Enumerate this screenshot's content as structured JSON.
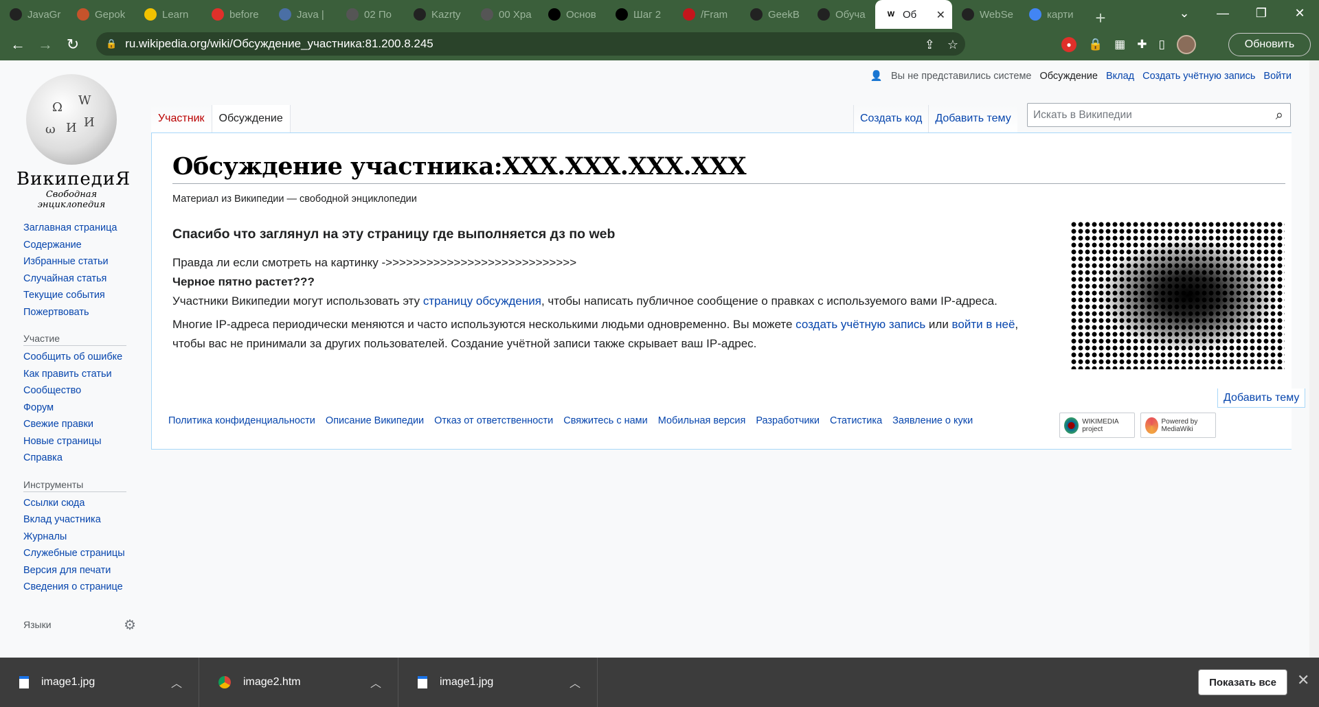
{
  "browser": {
    "tabs": [
      {
        "label": "JavaGr",
        "icon": "github-icon",
        "color": "#222"
      },
      {
        "label": "Gepok",
        "icon": "site-icon",
        "color": "#c5532b"
      },
      {
        "label": "Learn",
        "icon": "key-icon",
        "color": "#f2c200"
      },
      {
        "label": "before",
        "icon": "site-icon",
        "color": "#e0302a"
      },
      {
        "label": "Java |",
        "icon": "site-icon",
        "color": "#4a6fa5"
      },
      {
        "label": "02 По",
        "icon": "globe-icon",
        "color": "#555"
      },
      {
        "label": "Kazrty",
        "icon": "github-icon",
        "color": "#222"
      },
      {
        "label": "00 Хра",
        "icon": "globe-icon",
        "color": "#555"
      },
      {
        "label": "Основ",
        "icon": "site-icon",
        "color": "#000"
      },
      {
        "label": "Шаг 2",
        "icon": "site-icon",
        "color": "#000"
      },
      {
        "label": "/Fram",
        "icon": "site-icon",
        "color": "#c4161c"
      },
      {
        "label": "GeekB",
        "icon": "site-icon",
        "color": "#222"
      },
      {
        "label": "Обуча",
        "icon": "site-icon",
        "color": "#222"
      },
      {
        "label": "Об",
        "icon": "wikipedia-icon",
        "color": "#fff",
        "active": true
      },
      {
        "label": "WebSe",
        "icon": "github-icon",
        "color": "#222"
      },
      {
        "label": "карти",
        "icon": "google-icon",
        "color": "#4285f4"
      }
    ],
    "url": "ru.wikipedia.org/wiki/Обсуждение_участника:81.200.8.245",
    "update_button": "Обновить"
  },
  "wiki": {
    "wordmark": "ВикипедиЯ",
    "tagline": "Свободная энциклопедия",
    "nav_main": [
      "Заглавная страница",
      "Содержание",
      "Избранные статьи",
      "Случайная статья",
      "Текущие события",
      "Пожертвовать"
    ],
    "nav_participation_title": "Участие",
    "nav_participation": [
      "Сообщить об ошибке",
      "Как править статьи",
      "Сообщество",
      "Форум",
      "Свежие правки",
      "Новые страницы",
      "Справка"
    ],
    "nav_tools_title": "Инструменты",
    "nav_tools": [
      "Ссылки сюда",
      "Вклад участника",
      "Журналы",
      "Служебные страницы",
      "Версия для печати",
      "Сведения о странице"
    ],
    "languages_label": "Языки",
    "user": {
      "not_logged": "Вы не представились системе",
      "talk": "Обсуждение",
      "contrib": "Вклад",
      "create_account": "Создать учётную запись",
      "login": "Войти"
    },
    "ns_tabs": [
      "Участник",
      "Обсуждение"
    ],
    "actions": [
      "Создать код",
      "Добавить тему"
    ],
    "search_placeholder": "Искать в Википедии",
    "title": "Обсуждение участника:XXX.XXX.XXX.XXX",
    "sitesub": "Материал из Википедии — свободной энциклопедии",
    "heading": "Спасибо что заглянул на эту страницу где выполняется дз по web",
    "line1": "Правда ли если смотреть на картинку ->>>>>>>>>>>>>>>>>>>>>>>>>>>>",
    "line2": "Черное пятно растет???",
    "para1_a": "Участники Википедии могут использовать эту ",
    "para1_link": "страницу обсуждения",
    "para1_b": ", чтобы написать публичное сообщение о правках с используемого вами IP-адреса.",
    "para2_a": "Многие IP-адреса периодически меняются и часто используются несколькими людьми одновременно. Вы можете ",
    "para2_link1": "создать учётную запись",
    "para2_mid": " или ",
    "para2_link2": "войти в неё",
    "para2_b": ", чтобы вас не принимали за других пользователей. Создание учётной записи также скрывает ваш IP-адрес.",
    "add_topic_bottom": "Добавить тему",
    "footer_links": [
      "Политика конфиденциальности",
      "Описание Википедии",
      "Отказ от ответственности",
      "Свяжитесь с нами",
      "Мобильная версия",
      "Разработчики",
      "Статистика",
      "Заявление о куки"
    ],
    "badge_wikimedia": "WIKIMEDIA project",
    "badge_mediawiki": "Powered by MediaWiki"
  },
  "downloads": {
    "items": [
      "image1.jpg",
      "image2.htm",
      "image1.jpg"
    ],
    "show_all": "Показать все"
  }
}
